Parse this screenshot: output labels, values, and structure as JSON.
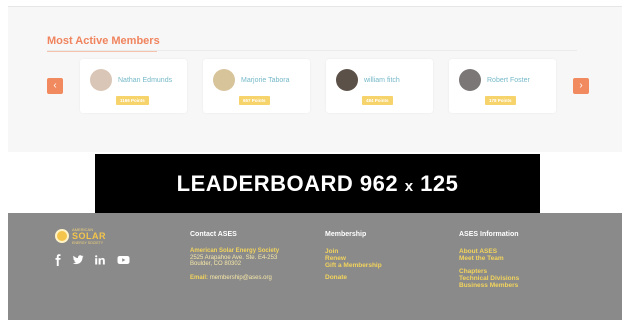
{
  "members": {
    "title": "Most Active Members",
    "prev_label": "‹",
    "next_label": "›",
    "cards": [
      {
        "name": "Nathan Edmunds",
        "points": "1166 Points",
        "avatar_color": "#d9c6b6"
      },
      {
        "name": "Marjorie Tabora",
        "points": "657 Points",
        "avatar_color": "#d7c49a"
      },
      {
        "name": "william fitch",
        "points": "484 Points",
        "avatar_color": "#5b5148"
      },
      {
        "name": "Robert Foster",
        "points": "178 Points",
        "avatar_color": "#7a7776"
      }
    ]
  },
  "ad": {
    "text_main": "LEADERBOARD 962 ",
    "text_x": "x",
    "text_end": " 125"
  },
  "footer": {
    "logo": {
      "top": "AMERICAN",
      "main": "SOLAR",
      "sub": "ENERGY SOCIETY"
    },
    "social": [
      "f",
      "t",
      "in",
      "yt"
    ],
    "contact": {
      "heading": "Contact ASES",
      "org": "American Solar Energy Society",
      "address1": "2525 Arapahoe Ave. Ste. E4-253",
      "address2": "Boulder, CO 80302",
      "email_label": "Email:",
      "email": "membership@ases.org"
    },
    "membership": {
      "heading": "Membership",
      "links": [
        "Join",
        "Renew",
        "Gift a Membership",
        "Donate"
      ]
    },
    "info": {
      "heading": "ASES Information",
      "links_a": [
        "About ASES",
        "Meet the Team"
      ],
      "links_b": [
        "Chapters",
        "Technical Divisions",
        "Business Members"
      ]
    }
  },
  "colors": {
    "accent": "#f0845e",
    "badge": "#f6d36b",
    "footer_bg": "#8a8a8a",
    "footer_link": "#f3d45c"
  }
}
